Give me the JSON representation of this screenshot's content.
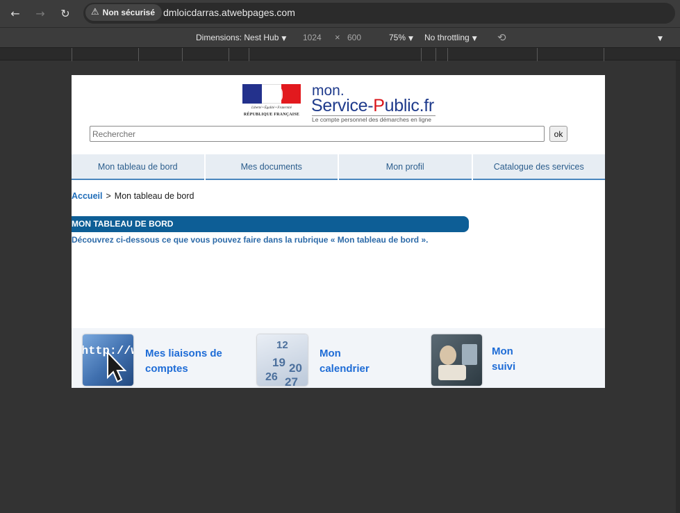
{
  "browser": {
    "security_label": "Non sécurisé",
    "url": "dmloicdarras.atwebpages.com"
  },
  "devtools": {
    "dimensions_label": "Dimensions: Nest Hub",
    "width": "1024",
    "times": "×",
    "height": "600",
    "zoom": "75%",
    "throttling": "No throttling"
  },
  "header": {
    "emblem_motto": "Liberté • Égalité • Fraternité",
    "emblem_republic": "RÉPUBLIQUE FRANÇAISE",
    "brand_mon": "mon.",
    "brand_service": "Service-",
    "brand_p": "P",
    "brand_rest": "ublic.fr",
    "tagline": "Le compte personnel des démarches en ligne"
  },
  "search": {
    "placeholder": "Rechercher",
    "button_label": "ok"
  },
  "nav": {
    "tabs": [
      {
        "label": "Mon tableau de bord"
      },
      {
        "label": "Mes documents"
      },
      {
        "label": "Mon profil"
      },
      {
        "label": "Catalogue des services"
      }
    ]
  },
  "breadcrumb": {
    "home": "Accueil",
    "separator": ">",
    "current": "Mon tableau de bord"
  },
  "section": {
    "title": "MON TABLEAU DE BORD",
    "intro": "Découvrez ci-dessous ce que vous pouvez faire dans la rubrique « Mon tableau de bord »."
  },
  "services": [
    {
      "line1": "Mes liaisons de",
      "line2": "comptes",
      "thumb_text": "http://ww"
    },
    {
      "line1": "Mon",
      "line2": "calendrier"
    },
    {
      "line1": "Mon",
      "line2": "suivi"
    }
  ],
  "calendar_numbers": [
    "12",
    "19",
    "20",
    "26",
    "27"
  ]
}
